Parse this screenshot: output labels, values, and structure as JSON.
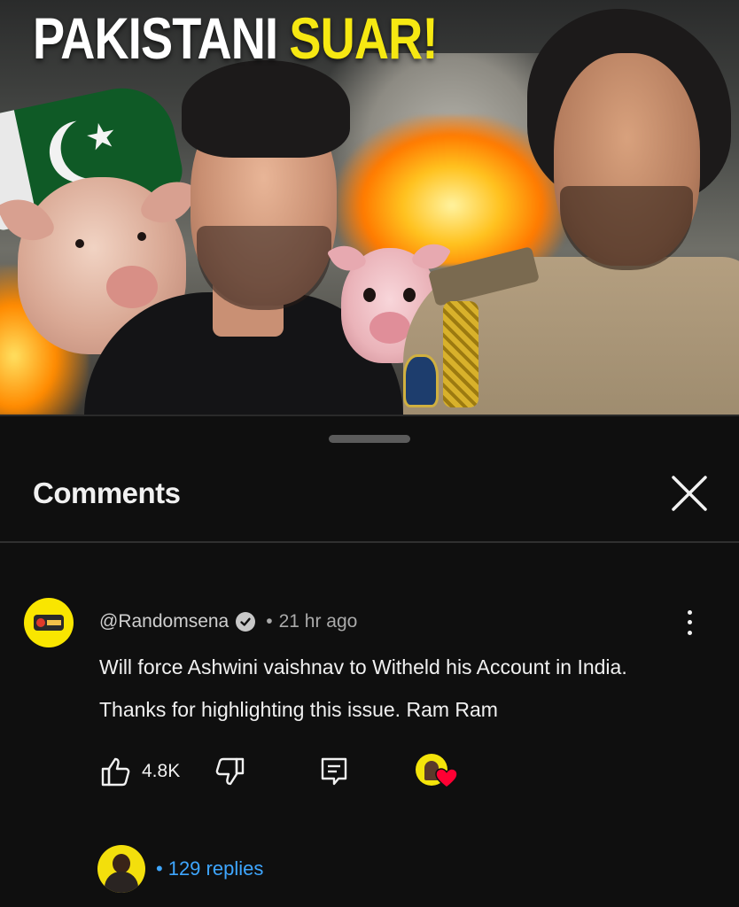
{
  "thumbnail": {
    "title_part1": "PAKISTANI",
    "title_part2": "SUAR!",
    "title_colors": {
      "part1": "#ffffff",
      "part2": "#f6e812"
    }
  },
  "sheet": {
    "title": "Comments",
    "close_icon": "close-icon"
  },
  "comment": {
    "author": "@Randomsena",
    "verified_icon": "verified-check-icon",
    "separator": "•",
    "time": "21 hr ago",
    "text_line1": "Will force Ashwini vaishnav to Witheld his Account in India.",
    "text_line2": "Thanks for highlighting this issue. Ram Ram",
    "likes": "4.8K",
    "icons": {
      "like": "thumbs-up-icon",
      "dislike": "thumbs-down-icon",
      "reply": "reply-icon",
      "menu": "more-vertical-icon",
      "creator_heart": "heart-icon"
    },
    "replies_separator": "•",
    "replies_label": "129 replies"
  },
  "colors": {
    "background": "#0f0f0f",
    "accent_link": "#3ea6ff",
    "heart": "#ff0033",
    "avatar_bg": "#f9e600"
  }
}
